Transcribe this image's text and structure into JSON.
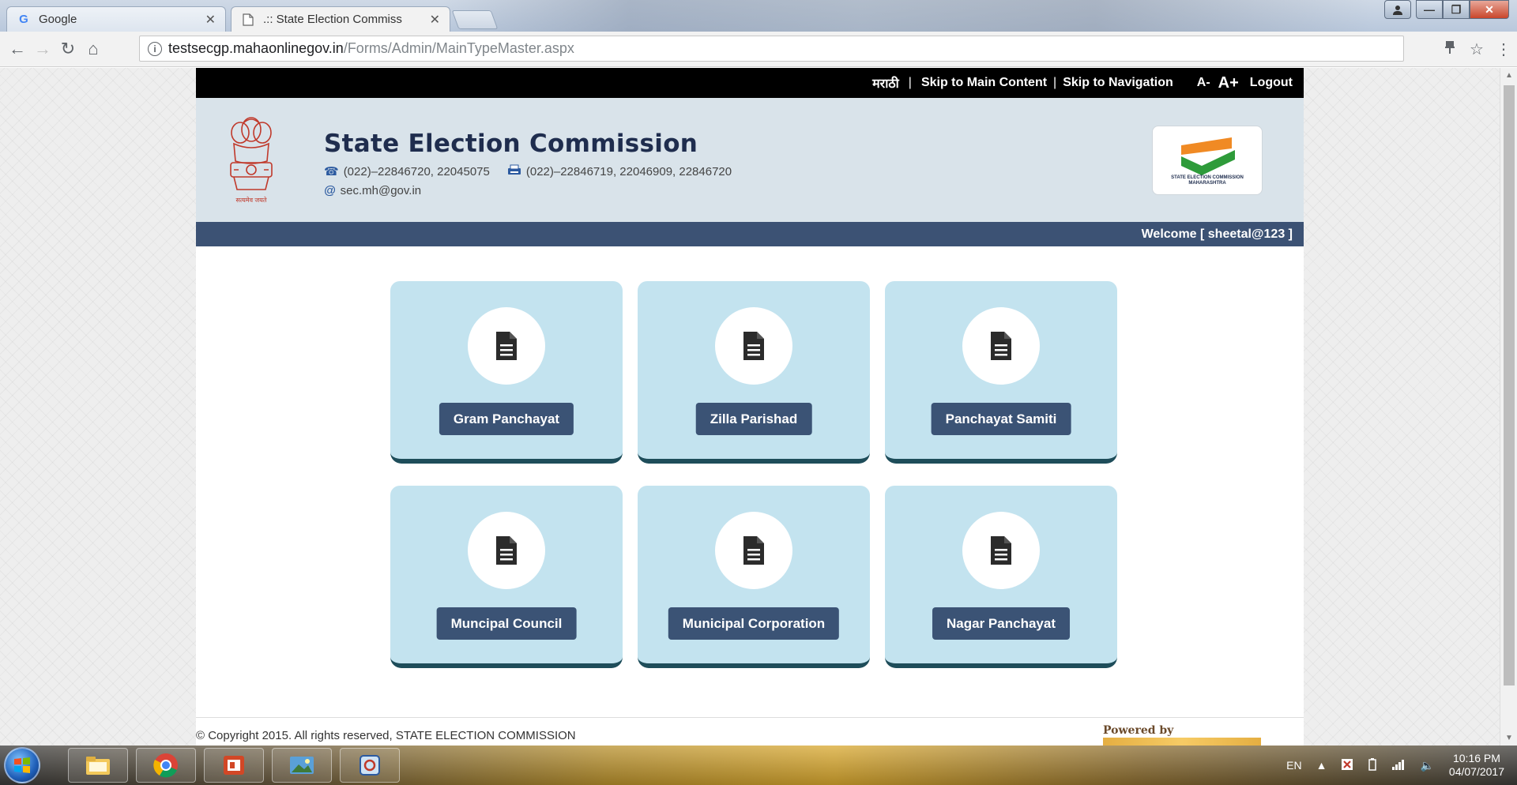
{
  "browser": {
    "tabs": [
      {
        "title": "Google",
        "favicon": "G"
      },
      {
        "title": ".:: State Election Commiss",
        "favicon": "page-icon"
      }
    ],
    "url_host": "testsecgp.mahaonlinegov.in",
    "url_path": "/Forms/Admin/MainTypeMaster.aspx"
  },
  "topbar": {
    "lang": "मराठी",
    "skip_main": "Skip to Main Content",
    "skip_nav": "Skip to Navigation",
    "font_decrease": "A-",
    "font_increase": "A+",
    "logout": "Logout"
  },
  "header": {
    "title": "State Election Commission",
    "phone": "(022)–22846720, 22045075",
    "fax": "(022)–22846719, 22046909, 22846720",
    "email": "sec.mh@gov.in",
    "emblem_motto": "सत्यमेव जयते",
    "logo_caption_1": "STATE ELECTION COMMISSION",
    "logo_caption_2": "MAHARASHTRA"
  },
  "welcome": "Welcome [ sheetal@123 ]",
  "tiles": [
    {
      "label": "Gram Panchayat"
    },
    {
      "label": "Zilla Parishad"
    },
    {
      "label": "Panchayat Samiti"
    },
    {
      "label": "Muncipal Council"
    },
    {
      "label": "Municipal Corporation"
    },
    {
      "label": "Nagar Panchayat"
    }
  ],
  "footer": {
    "copyright": "© Copyright 2015. All rights reserved, STATE ELECTION COMMISSION",
    "powered_by": "Powered by"
  },
  "taskbar": {
    "lang": "EN",
    "time": "10:16 PM",
    "date": "04/07/2017"
  },
  "colors": {
    "navy": "#3b5375",
    "tile_bg": "#c3e3ef",
    "header_bg": "#d9e3ea",
    "saffron": "#f08a24",
    "green": "#2e9b3a"
  }
}
